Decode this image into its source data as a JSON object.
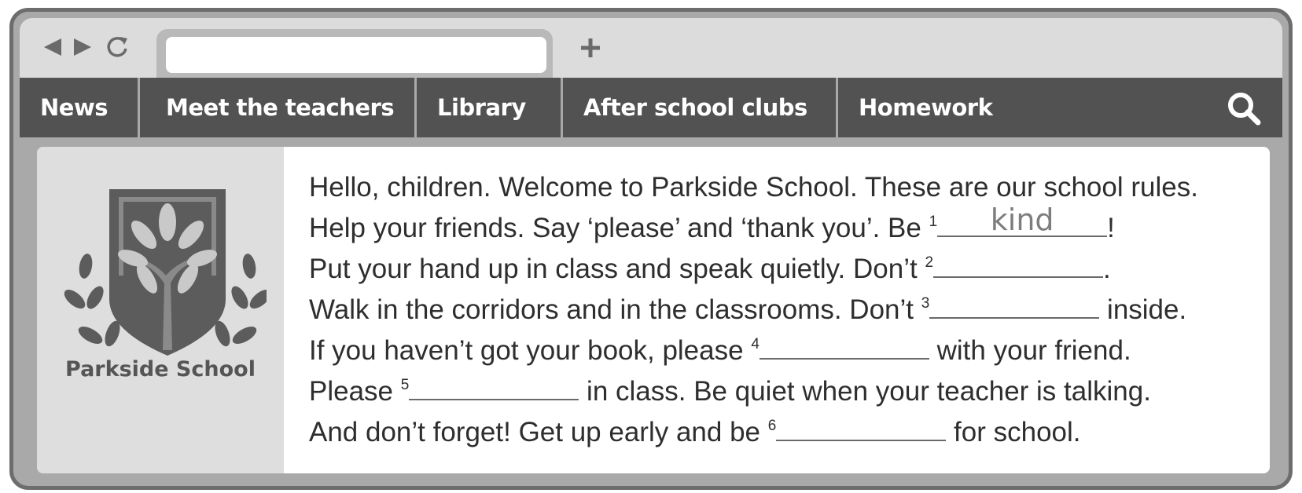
{
  "browser": {
    "address_value": "",
    "nav": {
      "back_icon": "back-arrow-icon",
      "forward_icon": "forward-arrow-icon",
      "refresh_icon": "refresh-icon"
    },
    "new_tab_icon": "plus-icon"
  },
  "menu": {
    "items": [
      {
        "label": "News"
      },
      {
        "label": "Meet the teachers"
      },
      {
        "label": "Library"
      },
      {
        "label": "After school clubs"
      },
      {
        "label": "Homework"
      }
    ],
    "search_icon": "search-icon"
  },
  "logo": {
    "school_name": "Parkside School"
  },
  "text": {
    "line1": "Hello, children. Welcome to Parkside School. These are our school rules.",
    "line2_before": "Help your friends. Say ‘please’ and ‘thank you’. Be ",
    "line2_num": "1",
    "line2_answer": "kind",
    "line2_after": "!",
    "line3_before": "Put your hand up in class and speak quietly. Don’t ",
    "line3_num": "2",
    "line3_after": ".",
    "line4_before": "Walk in the corridors and in the classrooms. Don’t ",
    "line4_num": "3",
    "line4_after": " inside.",
    "line5_before": "If you haven’t got your book, please ",
    "line5_num": "4",
    "line5_after": " with your friend.",
    "line6_before": "Please ",
    "line6_num": "5",
    "line6_after": " in class. Be quiet when your teacher is talking.",
    "line7_before": "And don’t forget! Get up early and be ",
    "line7_num": "6",
    "line7_after": " for school."
  },
  "colors": {
    "frame": "#6d6d6d",
    "menubar": "#525252",
    "text": "#2e2e2e",
    "answer": "#7d7d7d"
  }
}
